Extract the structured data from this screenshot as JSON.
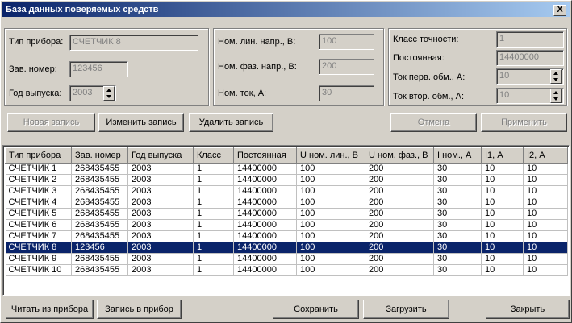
{
  "window": {
    "title": "База данных поверяемых средств",
    "close_label": "X"
  },
  "form": {
    "device_type_label": "Тип прибора:",
    "device_type_value": "СЧЕТЧИК 8",
    "serial_label": "Зав. номер:",
    "serial_value": "123456",
    "year_label": "Год выпуска:",
    "year_value": "2003",
    "line_voltage_label": "Ном. лин. напр., В:",
    "line_voltage_value": "100",
    "phase_voltage_label": "Ном. фаз. напр., В:",
    "phase_voltage_value": "200",
    "current_label": "Ном. ток, А:",
    "current_value": "30",
    "accuracy_label": "Класс точности:",
    "accuracy_value": "1",
    "constant_label": "Постоянная:",
    "constant_value": "14400000",
    "primary_current_label": "Ток перв. обм., А:",
    "primary_current_value": "10",
    "secondary_current_label": "Ток втор. обм., А:",
    "secondary_current_value": "10"
  },
  "record_buttons": {
    "new": "Новая запись",
    "edit": "Изменить запись",
    "delete": "Удалить запись",
    "cancel": "Отмена",
    "apply": "Применить"
  },
  "table": {
    "columns": [
      "Тип прибора",
      "Зав. номер",
      "Год выпуска",
      "Класс",
      "Постоянная",
      "U ном. лин., В",
      "U ном. фаз., В",
      "I ном., А",
      "I1, А",
      "I2, А"
    ],
    "rows": [
      [
        "СЧЕТЧИК 1",
        "268435455",
        "2003",
        "1",
        "14400000",
        "100",
        "200",
        "30",
        "10",
        "10"
      ],
      [
        "СЧЕТЧИК 2",
        "268435455",
        "2003",
        "1",
        "14400000",
        "100",
        "200",
        "30",
        "10",
        "10"
      ],
      [
        "СЧЕТЧИК 3",
        "268435455",
        "2003",
        "1",
        "14400000",
        "100",
        "200",
        "30",
        "10",
        "10"
      ],
      [
        "СЧЕТЧИК 4",
        "268435455",
        "2003",
        "1",
        "14400000",
        "100",
        "200",
        "30",
        "10",
        "10"
      ],
      [
        "СЧЕТЧИК 5",
        "268435455",
        "2003",
        "1",
        "14400000",
        "100",
        "200",
        "30",
        "10",
        "10"
      ],
      [
        "СЧЕТЧИК 6",
        "268435455",
        "2003",
        "1",
        "14400000",
        "100",
        "200",
        "30",
        "10",
        "10"
      ],
      [
        "СЧЕТЧИК 7",
        "268435455",
        "2003",
        "1",
        "14400000",
        "100",
        "200",
        "30",
        "10",
        "10"
      ],
      [
        "СЧЕТЧИК 8",
        "123456",
        "2003",
        "1",
        "14400000",
        "100",
        "200",
        "30",
        "10",
        "10"
      ],
      [
        "СЧЕТЧИК 9",
        "268435455",
        "2003",
        "1",
        "14400000",
        "100",
        "200",
        "30",
        "10",
        "10"
      ],
      [
        "СЧЕТЧИК 10",
        "268435455",
        "2003",
        "1",
        "14400000",
        "100",
        "200",
        "30",
        "10",
        "10"
      ]
    ],
    "selected_row": 7
  },
  "bottom_buttons": {
    "read": "Читать из прибора",
    "write": "Запись в прибор",
    "save": "Сохранить",
    "load": "Загрузить",
    "close": "Закрыть"
  }
}
